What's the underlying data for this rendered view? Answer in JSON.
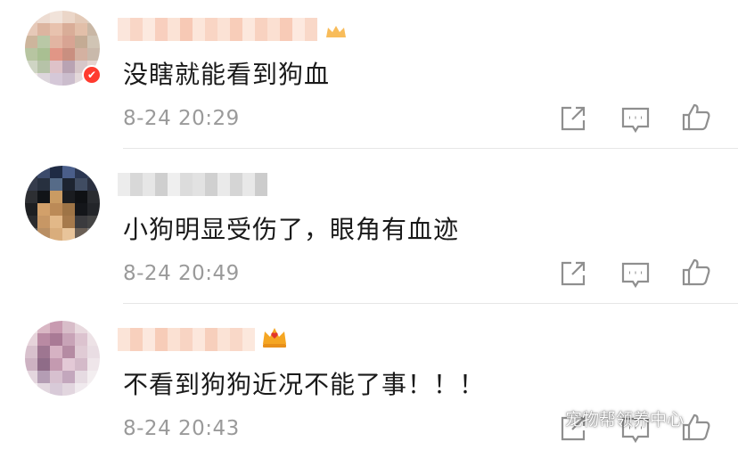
{
  "comments": [
    {
      "text": "没瞎就能看到狗血",
      "time": "8-24 20:29"
    },
    {
      "text": "小狗明显受伤了，眼角有血迹",
      "time": "8-24 20:49"
    },
    {
      "text": "不看到狗狗近况不能了事！！！",
      "time": "8-24 20:43"
    }
  ],
  "icons": {
    "share": "share-icon",
    "comment": "comment-icon",
    "like": "thumbs-up-icon",
    "badge": "verified-badge-icon",
    "crown": "crown-icon"
  },
  "colors": {
    "text": "#1a1a1a",
    "time": "#9a9a9a",
    "badge": "#ff3b2f",
    "crown": "#f5a623"
  },
  "watermark": {
    "text": "宠物帮领养中心"
  }
}
